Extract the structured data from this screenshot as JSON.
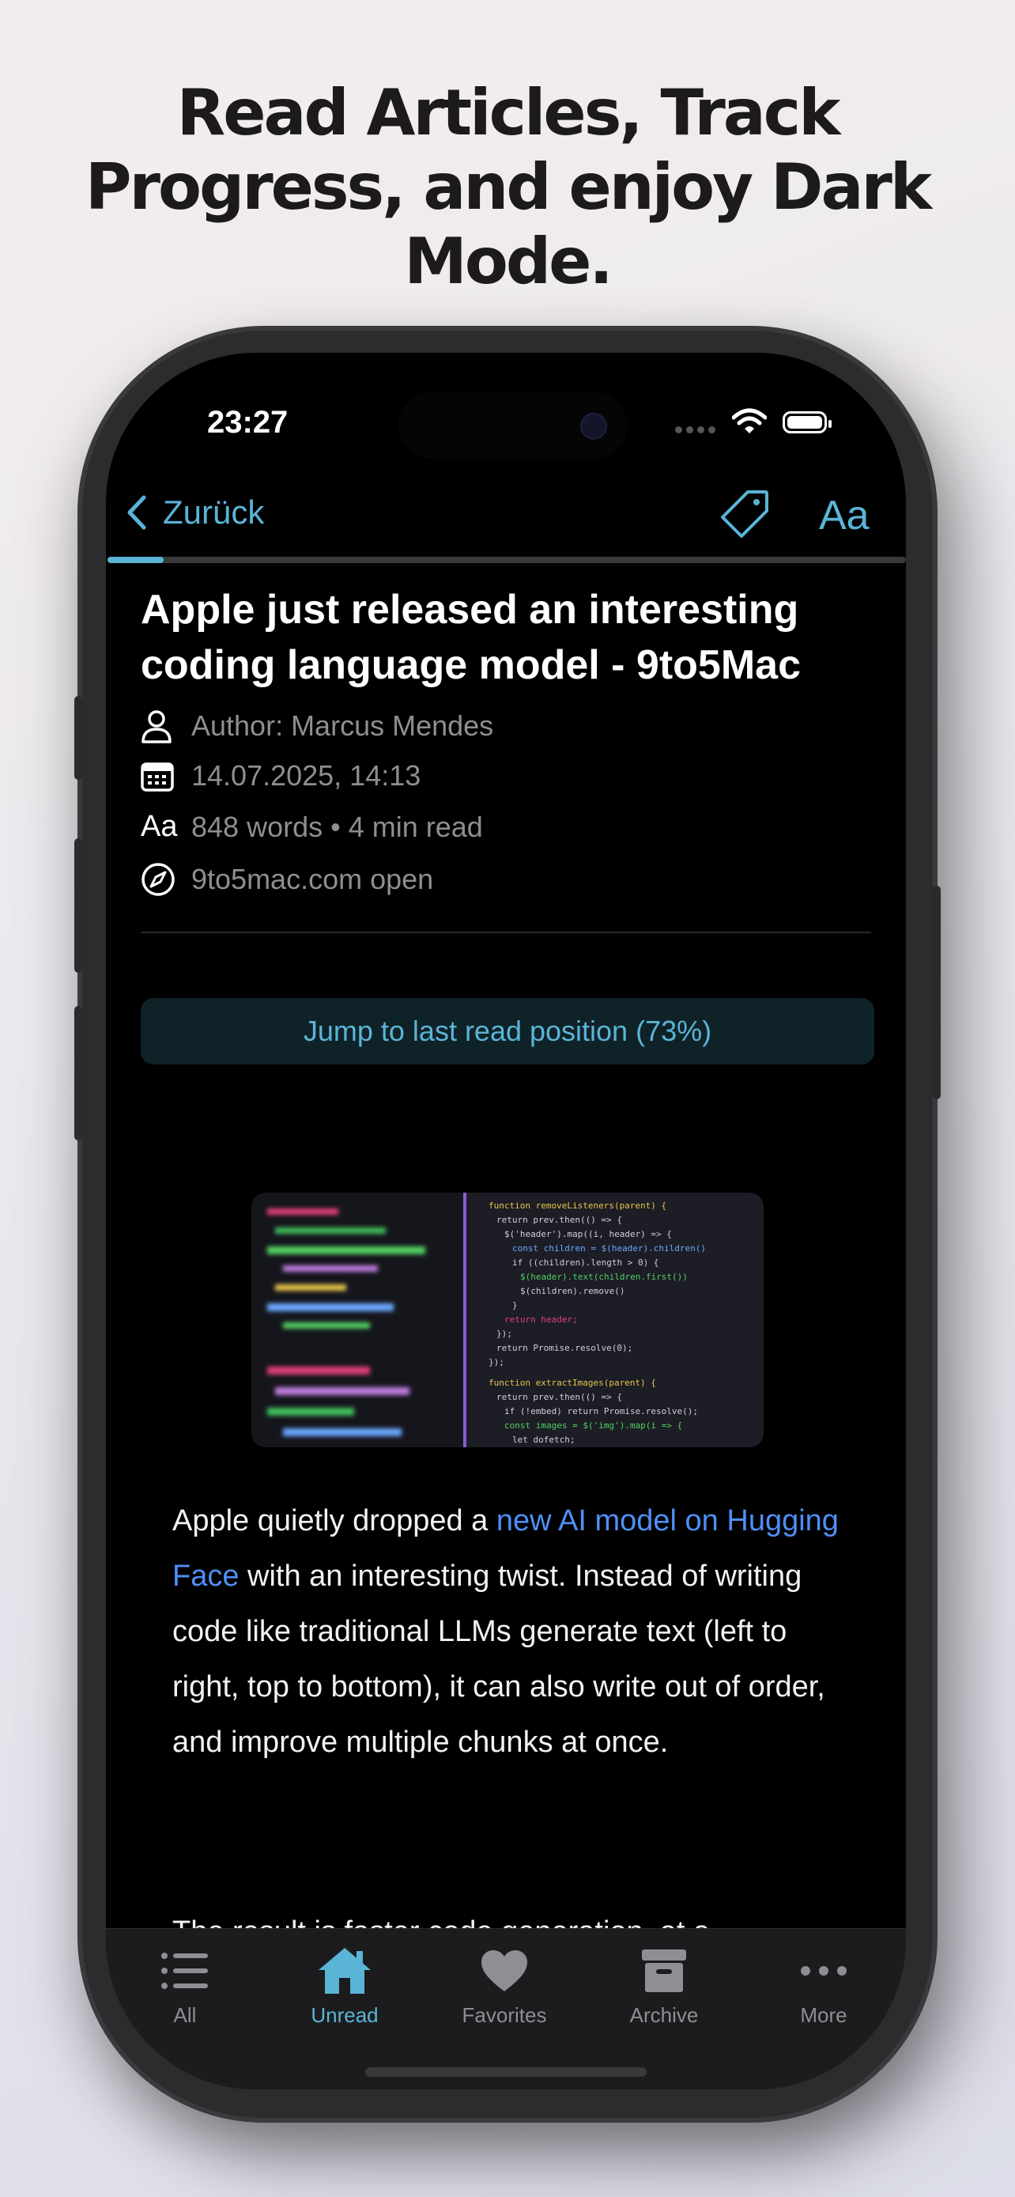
{
  "headline": {
    "line1": "Read Articles, Track",
    "line2": "Progress, and enjoy Dark",
    "line3": "Mode."
  },
  "status_bar": {
    "time": "23:27"
  },
  "nav": {
    "back_label": "Zurück",
    "tag_icon": "tag-icon",
    "font_button": "Aa"
  },
  "reading_progress": 0.07,
  "article": {
    "title": "Apple just released an interesting coding language model - 9to5Mac",
    "author": "Author: Marcus Mendes",
    "date": "14.07.2025, 14:13",
    "words_icon": "Aa",
    "reading_stats": "848 words • 4 min read",
    "source": "9to5mac.com open",
    "jump_button": "Jump to last read position (73%)",
    "p1_before": "Apple quietly dropped a ",
    "p1_link": "new AI model on Hugging Face",
    "p1_after": " with an interesting twist. Instead of writing code like traditional LLMs generate text (left to right, top to bottom), it can also write out of order, and improve multiple chunks at once.",
    "p2": "The result is faster code generation, at a"
  },
  "tabbar": {
    "items": [
      {
        "label": "All",
        "icon": "list-icon"
      },
      {
        "label": "Unread",
        "icon": "house-icon"
      },
      {
        "label": "Favorites",
        "icon": "heart-icon"
      },
      {
        "label": "Archive",
        "icon": "archive-box-icon"
      },
      {
        "label": "More",
        "icon": "ellipsis-icon"
      }
    ],
    "active": "Unread"
  },
  "colors": {
    "accent": "#5ab4d6",
    "link": "#4f8ff5",
    "background": "#000000",
    "secondary_text": "#8e8e93"
  }
}
